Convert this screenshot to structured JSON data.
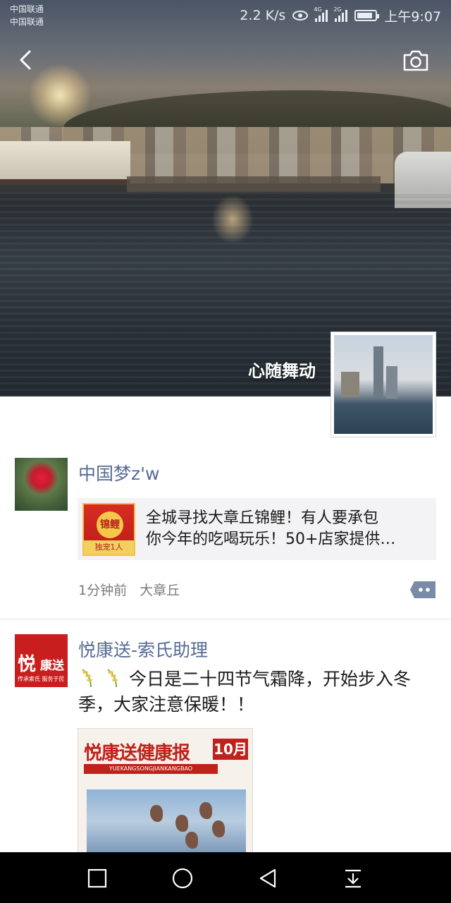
{
  "status_bar": {
    "carrier_1": "中国联通",
    "carrier_2": "中国联通",
    "speed": "2.2 K/s",
    "signal_1": "4G",
    "signal_2": "2G",
    "time": "上午9:07",
    "battery_level": 0.85
  },
  "cover": {
    "username": "心随舞动"
  },
  "posts": [
    {
      "author": "中国梦z'w",
      "share": {
        "thumb_badge": "锦鲤",
        "thumb_strip": "独宠1人",
        "line_1": "全城寻找大章丘锦鲤！有人要承包",
        "line_2": "你今年的吃喝玩乐！50+店家提供…"
      },
      "time": "1分钟前",
      "location": "大章丘"
    },
    {
      "author": "悦康送-索氏助理",
      "avatar_big": "悦",
      "avatar_small": "康送",
      "avatar_sub": "传承索氏 服务于民",
      "text": "今日是二十四节气霜降，开始步入冬季，大家注意保暖！！",
      "image": {
        "masthead": "悦康送健康报",
        "month": "10月",
        "pinyin": "YUEKANGSONGJIANKANGBAO"
      }
    }
  ],
  "icons": {
    "back": "back-chevron-icon",
    "camera": "camera-icon",
    "comment": "comment-dots-icon",
    "nav_recent": "square-icon",
    "nav_home": "circle-icon",
    "nav_back": "triangle-back-icon",
    "nav_notifications": "pull-down-icon"
  }
}
